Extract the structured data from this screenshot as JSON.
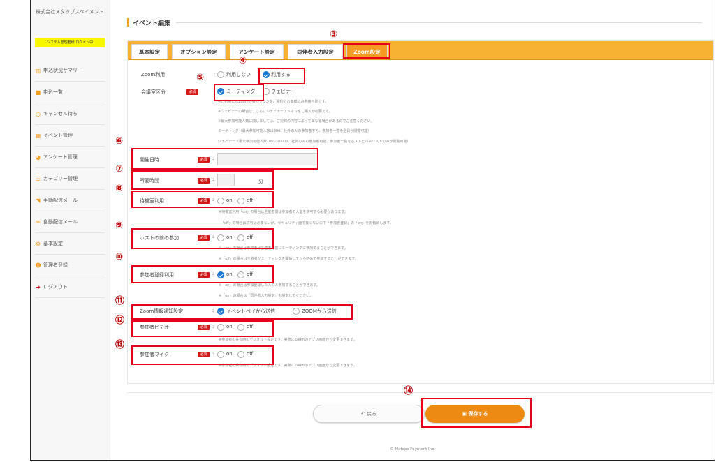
{
  "sidebar": {
    "company": "株式会社メタップスペイメント",
    "banner": "システム管理者様 ログイン中",
    "items": [
      {
        "label": "申込状況サマリー",
        "icon": "bar-chart-icon"
      },
      {
        "label": "申込一覧",
        "icon": "book-icon"
      },
      {
        "label": "キャンセル待ち",
        "icon": "clock-icon"
      },
      {
        "label": "イベント管理",
        "icon": "grid-icon"
      },
      {
        "label": "アンケート管理",
        "icon": "pie-chart-icon"
      },
      {
        "label": "カテゴリー管理",
        "icon": "list-icon"
      },
      {
        "label": "手動配信メール",
        "icon": "rss-icon"
      },
      {
        "label": "自動配信メール",
        "icon": "mail-icon"
      },
      {
        "label": "基本設定",
        "icon": "gears-icon"
      },
      {
        "label": "管理者登録",
        "icon": "users-icon"
      },
      {
        "label": "ログアウト",
        "icon": "logout-icon"
      }
    ]
  },
  "page": {
    "title": "イベント編集"
  },
  "tabs": [
    "基本設定",
    "オプション設定",
    "アンケート設定",
    "同伴者入力設定",
    "Zoom設定"
  ],
  "required_badge": "必須",
  "form": {
    "zoom_use": {
      "label": "Zoom利用",
      "opt1": "利用しない",
      "opt2": "利用する"
    },
    "room_type": {
      "label": "会議室区分",
      "opt1": "ミーティング",
      "opt2": "ウェビナー"
    },
    "room_notes": [
      "※ご利用にはZoomの有料プランをご契約のお客様のみ利用可能です。",
      "※ウェビナーの場合は、さらにウェビナーアドオンをご購入が必要です。",
      "※最大参加可能人数に関しましては、ご契約の内容によって異なる場合があるのでご注意ください。",
      "ミーティング（最大参加可能人数は300、社外のみの参加者不可、参加者一覧を全員が閲覧可能）",
      "ウェビナー（最大参加可能人数100 - 10000、社外のみの参加者可能、参加者一覧をホストとパネリストのみが閲覧可能）"
    ],
    "start_time": {
      "label": "開催日時"
    },
    "duration": {
      "label": "所要時間",
      "unit": "分"
    },
    "waiting_room": {
      "label": "待機室利用",
      "opt1": "on",
      "opt2": "off"
    },
    "waiting_notes": [
      "※待機室利用「on」の場合は主催者側は参加者の入室を許可する必要があります。",
      "「off」の場合は許可は必要ないが、セキュリティ面で良くないので「参加者登録」の「on」をお勧めします。"
    ],
    "join_before_host": {
      "label": "ホストの前の参加",
      "opt1": "on",
      "opt2": "off"
    },
    "join_notes": [
      "※「on」の場合は参加者は主催者の前にミーティングに参加することができます。",
      "※「off」の場合は主催者がミーティングを開始してから初めて参加することができます。"
    ],
    "registration": {
      "label": "参加者登録利用",
      "opt1": "on",
      "opt2": "off"
    },
    "registration_notes": [
      "※「on」の場合は参加登録した人のみ参加することができます。",
      "※「on」の場合は「同伴者入力設定」も設定してください。"
    ],
    "notification": {
      "label": "Zoom情報通知設定",
      "opt1": "イベントペイから送信",
      "opt2": "ZOOMから送信"
    },
    "video": {
      "label": "参加者ビデオ",
      "opt1": "on",
      "opt2": "off",
      "note": "※参加者の共有時のデフォルト設定です。実際にZoomのアプリ画面から変更できます。"
    },
    "mic": {
      "label": "参加者マイク",
      "opt1": "on",
      "opt2": "off",
      "note": "※参加者の共有時のデフォルト設定です。実際にZoomのアプリ画面から変更できます。"
    }
  },
  "buttons": {
    "back": "戻る",
    "save": "保存する"
  },
  "footer": "© Metaps Payment Inc.",
  "callouts": [
    "③",
    "④",
    "⑤",
    "⑥",
    "⑦",
    "⑧",
    "⑨",
    "⑩",
    "⑪",
    "⑫",
    "⑬",
    "⑭"
  ],
  "colors": {
    "accent": "#f59a23",
    "tab_bar": "#f7b233",
    "required": "#d41818",
    "highlight": "#e8001a",
    "radio_checked": "#1a78d4"
  }
}
